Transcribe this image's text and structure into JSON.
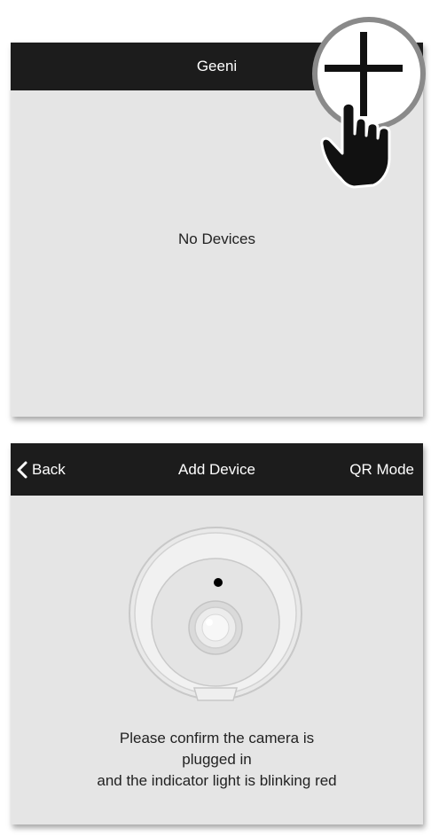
{
  "screen_list": {
    "title": "Geeni",
    "empty_message": "No Devices",
    "add_button_icon": "plus-icon",
    "pointer_icon": "hand-pointer-icon"
  },
  "screen_add_device": {
    "back_icon": "chevron-left-icon",
    "back_label": "Back",
    "title": "Add Device",
    "qr_mode_label": "QR Mode",
    "camera_icon": "camera-illustration",
    "instructions": [
      "Please confirm the camera is",
      "plugged in",
      "and the indicator light is blinking red"
    ]
  },
  "colors": {
    "header_bg": "#1c1c1c",
    "panel_bg": "#e5e5e5",
    "header_text": "#ffffff",
    "body_text": "#222222",
    "indicator_dot": "#000000"
  }
}
